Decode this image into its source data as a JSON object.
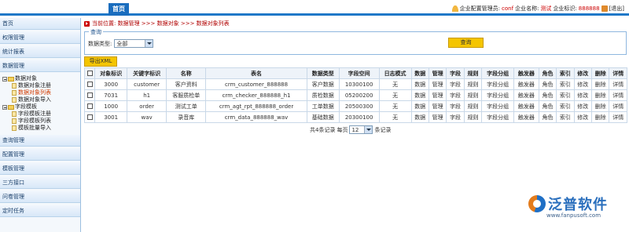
{
  "topbar": {
    "home_tab": "首页",
    "admin_label": "企业配置管理员:",
    "admin_name": "conf",
    "company_label": "企业名称:",
    "company_name": "测试",
    "code_label": "企业标识:",
    "code_value": "888888",
    "logout": "[退出]"
  },
  "sidebar": {
    "items_top": [
      "首页",
      "权限管理",
      "统计报表",
      "数据管理"
    ],
    "tree": [
      {
        "group": "数据对象",
        "leaves": [
          "数据对象注册",
          "数据对象列表",
          "数据对象导入"
        ],
        "active": 1
      },
      {
        "group": "字段模板",
        "leaves": [
          "字段模板注册",
          "字段模板列表",
          "模板批量导入"
        ],
        "active": -1
      }
    ],
    "items_bottom": [
      "查询管理",
      "配置管理",
      "模板管理",
      "三方接口",
      "问卷管理",
      "定时任务"
    ]
  },
  "breadcrumb": "当前位置: 数据管理 >>> 数据对象 >>> 数据对象列表",
  "query": {
    "legend": "查询",
    "type_label": "数据类型:",
    "type_value": "全部",
    "button": "查询"
  },
  "export_button": "导出XML",
  "table": {
    "headers": [
      "",
      "对象标识",
      "关键字标识",
      "名称",
      "表名",
      "数据类型",
      "字段空间",
      "日志模式",
      "数据",
      "管理",
      "字段",
      "规则",
      "字段分组",
      "触发器",
      "角色",
      "索引",
      "修改",
      "删除",
      "详情"
    ],
    "rows": [
      [
        "3000",
        "customer",
        "客户资料",
        "crm_customer_888888",
        "客户数据",
        "10300100",
        "无",
        "数据",
        "管理",
        "字段",
        "规则",
        "字段分组",
        "触发器",
        "角色",
        "索引",
        "修改",
        "删除",
        "详情"
      ],
      [
        "7031",
        "h1",
        "客服质检单",
        "crm_checker_888888_h1",
        "质检数据",
        "05200200",
        "无",
        "数据",
        "管理",
        "字段",
        "规则",
        "字段分组",
        "触发器",
        "角色",
        "索引",
        "修改",
        "删除",
        "详情"
      ],
      [
        "1000",
        "order",
        "测试工单",
        "crm_agt_rpt_888888_order",
        "工单数据",
        "20500300",
        "无",
        "数据",
        "管理",
        "字段",
        "规则",
        "字段分组",
        "触发器",
        "角色",
        "索引",
        "修改",
        "删除",
        "详情"
      ],
      [
        "3001",
        "wav",
        "录音库",
        "crm_data_888888_wav",
        "基础数据",
        "20300100",
        "无",
        "数据",
        "管理",
        "字段",
        "规则",
        "字段分组",
        "触发器",
        "角色",
        "索引",
        "修改",
        "删除",
        "详情"
      ]
    ]
  },
  "pager": {
    "total_text": "共4条记录",
    "per_page_label": "每页",
    "per_page_value": "12",
    "unit": "条记录"
  },
  "watermark": {
    "brand": "泛普软件",
    "url": "www.fanpusoft.com"
  }
}
